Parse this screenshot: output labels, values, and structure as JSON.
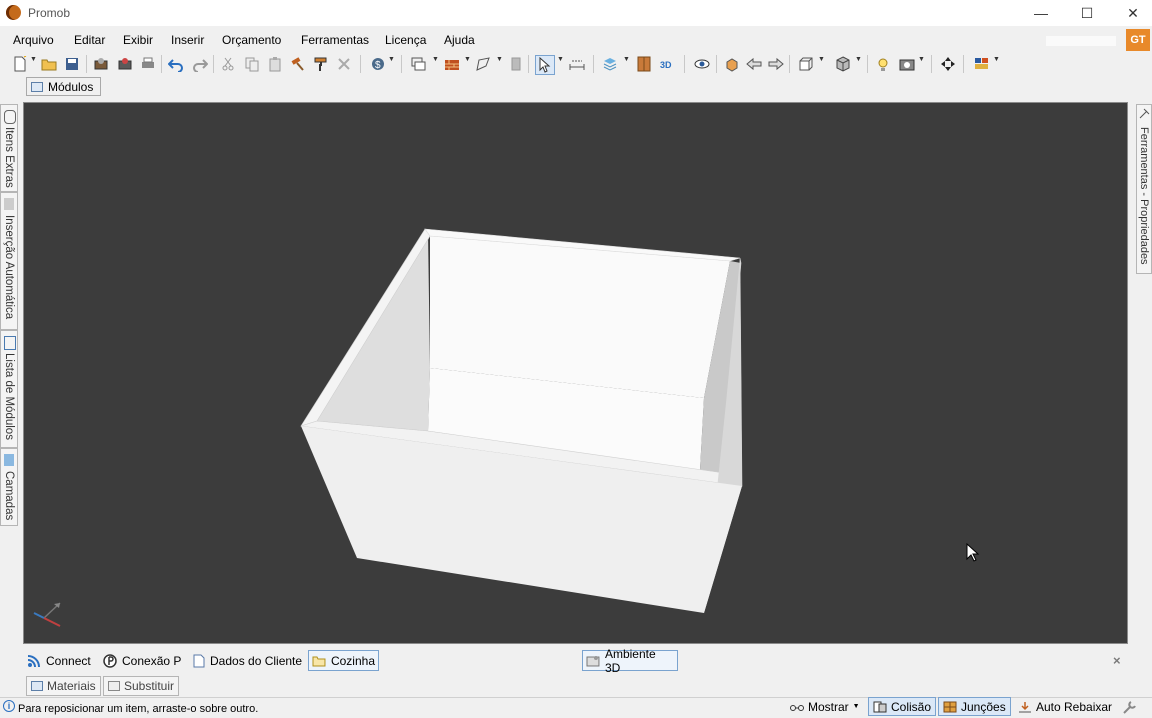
{
  "window": {
    "title": "Promob",
    "minimize": "—",
    "maximize": "☐",
    "close": "✕"
  },
  "menu": [
    "Arquivo",
    "Editar",
    "Exibir",
    "Inserir",
    "Orçamento",
    "Ferramentas",
    "Licença",
    "Ajuda"
  ],
  "user_badge": "GT",
  "modulos_tab": "Módulos",
  "left_panels": [
    "Itens Extras",
    "Inserção Automática",
    "Lista de Módulos",
    "Camadas"
  ],
  "right_panel": "Ferramentas - Propriedades",
  "bottom_tabs": {
    "connect": "Connect",
    "conexao": "Conexão P",
    "dados": "Dados do Cliente",
    "cozinha": "Cozinha",
    "ambiente": "Ambiente 3D",
    "close": "×"
  },
  "material_tabs": [
    "Materiais",
    "Substituir"
  ],
  "status": {
    "hint": "Para reposicionar um item, arraste-o sobre outro.",
    "mostrar": "Mostrar",
    "colisao": "Colisão",
    "juncoes": "Junções",
    "auto_rebaixar": "Auto Rebaixar"
  },
  "colors": {
    "viewport_bg": "#3c3c3c",
    "accent": "#e8892a",
    "selection": "#7aa3cf"
  }
}
